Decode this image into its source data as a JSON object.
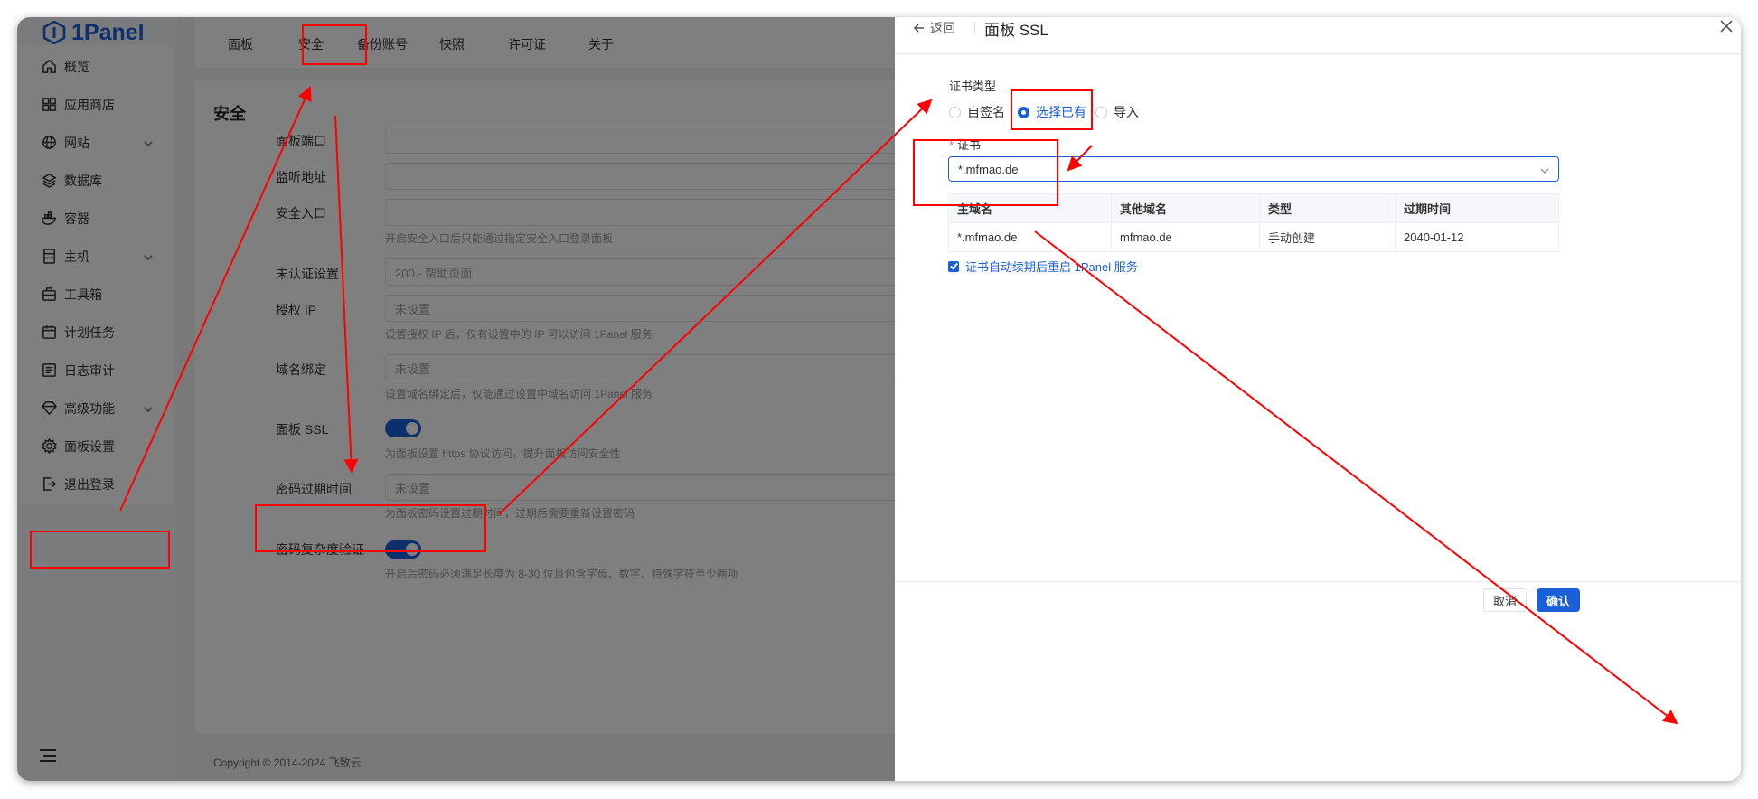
{
  "brand": "1Panel",
  "sidebar": {
    "items": [
      {
        "label": "概览",
        "icon": "home-icon"
      },
      {
        "label": "应用商店",
        "icon": "grid-icon"
      },
      {
        "label": "网站",
        "icon": "globe-icon"
      },
      {
        "label": "数据库",
        "icon": "layers-icon"
      },
      {
        "label": "容器",
        "icon": "docker-icon"
      },
      {
        "label": "主机",
        "icon": "server-icon"
      },
      {
        "label": "工具箱",
        "icon": "toolbox-icon"
      },
      {
        "label": "计划任务",
        "icon": "calendar-icon"
      },
      {
        "label": "日志审计",
        "icon": "log-icon"
      },
      {
        "label": "高级功能",
        "icon": "diamond-icon"
      },
      {
        "label": "面板设置",
        "icon": "gear-icon"
      },
      {
        "label": "退出登录",
        "icon": "logout-icon"
      }
    ]
  },
  "tabs": [
    "面板",
    "安全",
    "备份账号",
    "快照",
    "许可证",
    "关于"
  ],
  "security": {
    "title": "安全",
    "panel_port_label": "面板端口",
    "listen_addr_label": "监听地址",
    "entrance_label": "安全入口",
    "entrance_hint": "开启安全入口后只能通过指定安全入口登录面板",
    "unauth_label": "未认证设置",
    "unauth_value": "200 - 帮助页面",
    "auth_ip_label": "授权 IP",
    "auth_ip_placeholder": "未设置",
    "auth_ip_hint": "设置授权 IP 后，仅有设置中的 IP 可以访问 1Panel 服务",
    "domain_label": "域名绑定",
    "domain_placeholder": "未设置",
    "domain_hint": "设置域名绑定后，仅能通过设置中域名访问 1Panel 服务",
    "ssl_label": "面板 SSL",
    "ssl_hint": "为面板设置 https 协议访问，提升面板访问安全性",
    "expire_label": "密码过期时间",
    "expire_placeholder": "未设置",
    "expire_hint": "为面板密码设置过期时间，过期后需要重新设置密码",
    "complexity_label": "密码复杂度验证",
    "complexity_hint": "开启后密码必须满足长度为 8-30 位且包含字母、数字、特殊字符至少两项"
  },
  "footer": {
    "copyright": "Copyright © 2014-2024 飞致云"
  },
  "drawer": {
    "back_label": "返回",
    "title": "面板 SSL",
    "cert_type_label": "证书类型",
    "radio_options": [
      "自签名",
      "选择已有",
      "导入"
    ],
    "selected_option": "选择已有",
    "cert_label": "证书",
    "cert_value": "*.mfmao.de",
    "table": {
      "headers": [
        "主域名",
        "其他域名",
        "类型",
        "过期时间"
      ],
      "rows": [
        [
          "*.mfmao.de",
          "mfmao.de",
          "手动创建",
          "2040-01-12"
        ]
      ]
    },
    "restart_label": "证书自动续期后重启 1Panel 服务",
    "cancel_label": "取消",
    "confirm_label": "确认"
  },
  "colors": {
    "accent": "#1a5fd8",
    "annotation": "#ff0000"
  }
}
